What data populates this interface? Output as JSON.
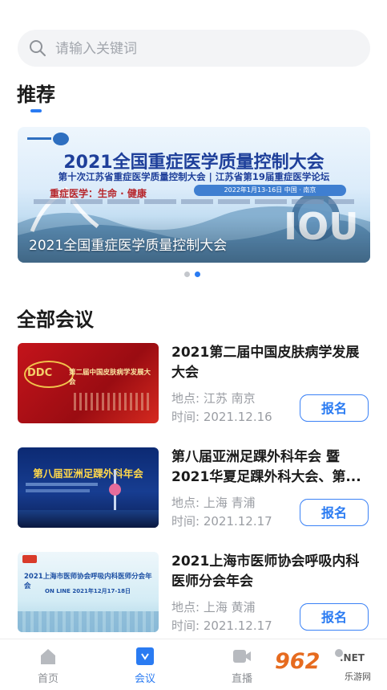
{
  "search": {
    "placeholder": "请输入关键词"
  },
  "recommend": {
    "title": "推荐",
    "banner": {
      "headline": "2021全国重症医学质量控制大会",
      "subheadline": "第十次江苏省重症医学质量控制大会 | 江苏省第19届重症医学论坛",
      "slogan": "重症医学：生命 · 健康",
      "date": "2022年1月13-16日 中国 · 南京",
      "caption": "2021全国重症医学质量控制大会"
    },
    "dots": {
      "count": 2,
      "active_index": 1,
      "colors": {
        "active": "#2a7bf2",
        "inactive": "#c4c7cc"
      }
    }
  },
  "all": {
    "title": "全部会议",
    "items": [
      {
        "thumb_text": "第二届中国皮肤病学发展大会",
        "thumb_badge": "DDC",
        "title": "2021第二届中国皮肤病学发展大会",
        "location": "地点: 江苏 南京",
        "time": "时间: 2021.12.16",
        "button": "报名"
      },
      {
        "thumb_text": "第八届亚洲足踝外科年会",
        "thumb_badge": "",
        "title": "第八届亚洲足踝外科年会 暨2021华夏足踝外科大会、第...",
        "location": "地点: 上海 青浦",
        "time": "时间: 2021.12.17",
        "button": "报名"
      },
      {
        "thumb_text": "2021上海市医师协会呼吸内科医师分会年会",
        "thumb_badge": "ON LINE  2021年12月17-18日",
        "title": "2021上海市医师协会呼吸内科医师分会年会",
        "location": "地点: 上海 黄浦",
        "time": "时间: 2021.12.17",
        "button": "报名"
      }
    ]
  },
  "tabbar": {
    "tabs": [
      {
        "label": "首页",
        "icon": "home-icon"
      },
      {
        "label": "会议",
        "icon": "meeting-icon"
      },
      {
        "label": "直播",
        "icon": "video-camera-icon"
      },
      {
        "label": "",
        "icon": "user-icon"
      }
    ],
    "active_index": 1
  },
  "watermark": {
    "text": "962",
    "suffix": ".NET",
    "sub": "乐游网"
  },
  "colors": {
    "accent": "#2a7bf2",
    "meta_text": "#9a9da3",
    "search_bg": "#f3f4f6"
  }
}
